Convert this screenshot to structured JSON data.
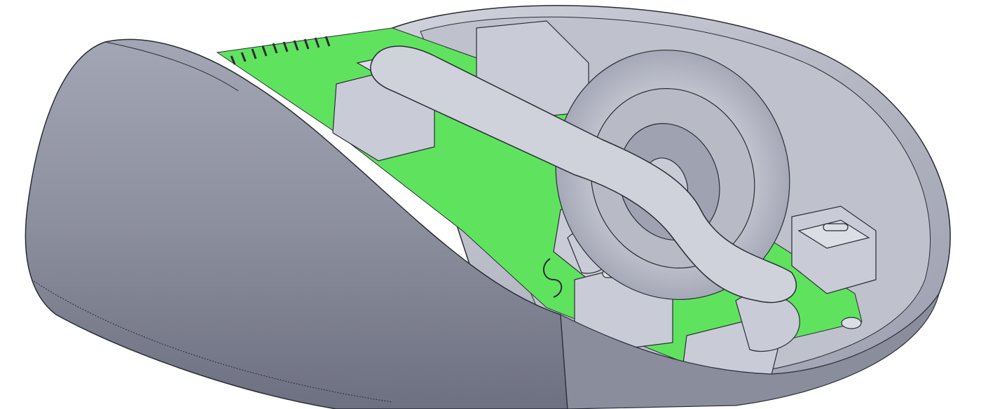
{
  "image": {
    "subject": "cad-render-computer-mouse-cutaway",
    "colors": {
      "background": "#ffffff",
      "shell": "#8c8f9e",
      "shell_light": "#b4b7c4",
      "internals": "#c9cbd6",
      "pcb": "#5fe35f",
      "edge": "#2a2c35"
    }
  }
}
